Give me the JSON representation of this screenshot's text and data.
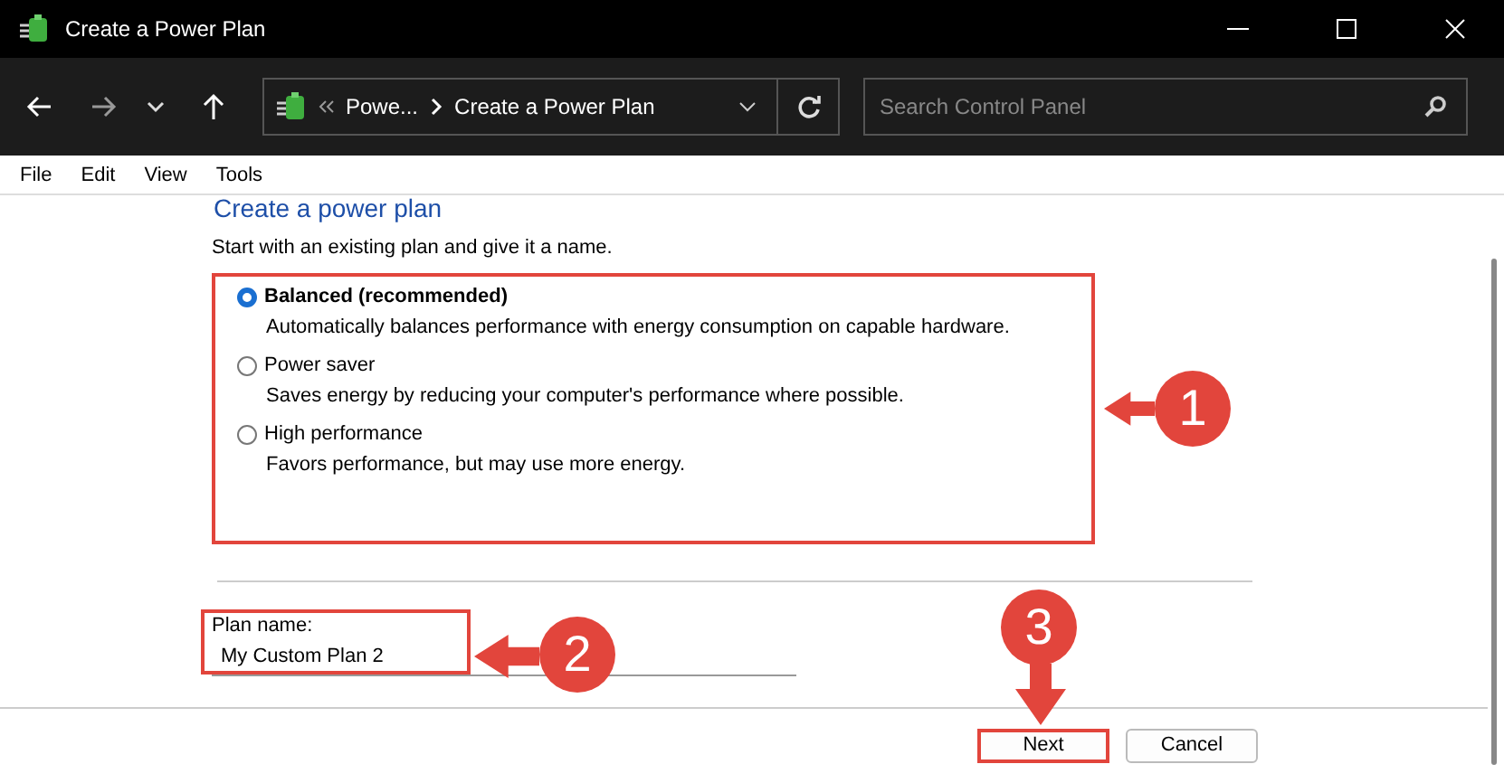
{
  "window": {
    "title": "Create a Power Plan"
  },
  "address_bar": {
    "crumbs": [
      "Powe...",
      "Create a Power Plan"
    ]
  },
  "search": {
    "placeholder": "Search Control Panel"
  },
  "menu": [
    "File",
    "Edit",
    "View",
    "Tools"
  ],
  "heading": "Create a power plan",
  "intro": "Start with an existing plan and give it a name.",
  "plans": [
    {
      "label": "Balanced (recommended)",
      "description": "Automatically balances performance with energy consumption on capable hardware.",
      "selected": true
    },
    {
      "label": "Power saver",
      "description": "Saves energy by reducing your computer's performance where possible.",
      "selected": false
    },
    {
      "label": "High performance",
      "description": "Favors performance, but may use more energy.",
      "selected": false
    }
  ],
  "plan_name": {
    "label": "Plan name:",
    "value": "My Custom Plan 2"
  },
  "buttons": [
    "Next",
    "Cancel"
  ],
  "callouts": [
    "1",
    "2",
    "3"
  ]
}
